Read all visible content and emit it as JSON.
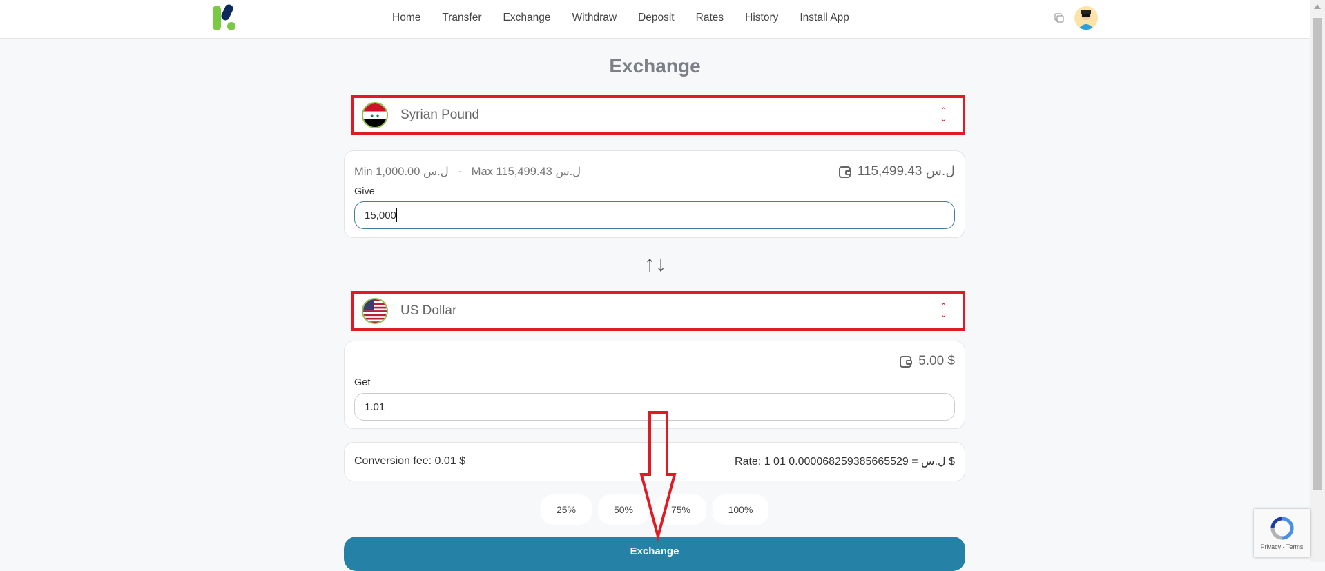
{
  "nav": {
    "items": [
      "Home",
      "Transfer",
      "Exchange",
      "Withdraw",
      "Deposit",
      "Rates",
      "History",
      "Install App"
    ]
  },
  "page": {
    "title": "Exchange"
  },
  "from": {
    "currency": "Syrian Pound",
    "flag": "syria-flag",
    "min": "Min 1,000.00 ل.س",
    "separator": "-",
    "max": "Max 115,499.43 ل.س",
    "balance": "115,499.43 ل.س",
    "field_label": "Give",
    "value": "15,000"
  },
  "to": {
    "currency": "US Dollar",
    "flag": "usa-flag",
    "balance": "5.00 $",
    "field_label": "Get",
    "value": "1.01"
  },
  "info": {
    "fee": "Conversion fee: 0.01 $",
    "rate": "Rate: 1 ل.س = 0.000068259385665529 01 $"
  },
  "percent_buttons": [
    "25%",
    "50%",
    "75%",
    "100%"
  ],
  "submit_label": "Exchange",
  "recaptcha": {
    "links": "Privacy - Terms"
  },
  "colors": {
    "primary": "#2681a7",
    "annotation": "#e01b24",
    "logo_green": "#7ac943",
    "logo_navy": "#0d2a5c"
  }
}
